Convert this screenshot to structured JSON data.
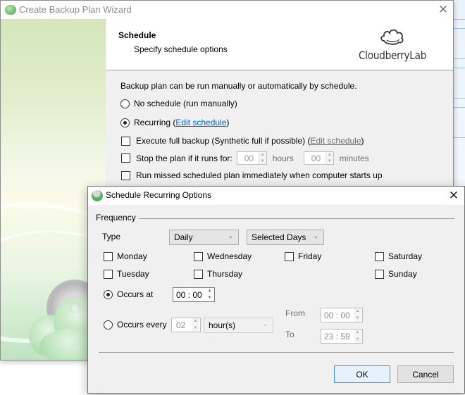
{
  "wizard": {
    "title": "Create Backup Plan Wizard",
    "header": {
      "title": "Schedule",
      "subtitle": "Specify schedule options",
      "brand": "CloudberryLab"
    },
    "intro": "Backup plan can be run manually or automatically by schedule.",
    "options": {
      "no_schedule": {
        "label": "No schedule (run manually)",
        "selected": false
      },
      "recurring": {
        "label": "Recurring",
        "link": "Edit schedule",
        "selected": true
      },
      "full_backup": {
        "label": "Execute full backup (Synthetic full if possible)",
        "link": "Edit schedule",
        "checked": false
      },
      "stop_plan": {
        "label": "Stop the plan if it runs for:",
        "hours_value": "00",
        "hours_label": "hours",
        "minutes_value": "00",
        "minutes_label": "minutes",
        "checked": false
      },
      "run_missed": {
        "label": "Run missed scheduled plan immediately when computer starts up",
        "checked": false
      }
    }
  },
  "dialog": {
    "title": "Schedule Recurring Options",
    "frequency_label": "Frequency",
    "type_label": "Type",
    "type_value": "Daily",
    "days_mode_value": "Selected Days",
    "days": [
      {
        "label": "Monday",
        "checked": false
      },
      {
        "label": "Wednesday",
        "checked": false
      },
      {
        "label": "Friday",
        "checked": false
      },
      {
        "label": "Saturday",
        "checked": false
      },
      {
        "label": "Tuesday",
        "checked": false
      },
      {
        "label": "Thursday",
        "checked": false
      },
      {
        "label": "Sunday",
        "checked": false
      }
    ],
    "occurs_at": {
      "label": "Occurs at",
      "value": "00 : 00",
      "selected": true
    },
    "occurs_every": {
      "label": "Occurs every",
      "value": "02",
      "unit": "hour(s)",
      "selected": false
    },
    "from": {
      "label": "From",
      "value": "00 : 00"
    },
    "to": {
      "label": "To",
      "value": "23 : 59"
    },
    "ok_label": "OK",
    "cancel_label": "Cancel"
  }
}
